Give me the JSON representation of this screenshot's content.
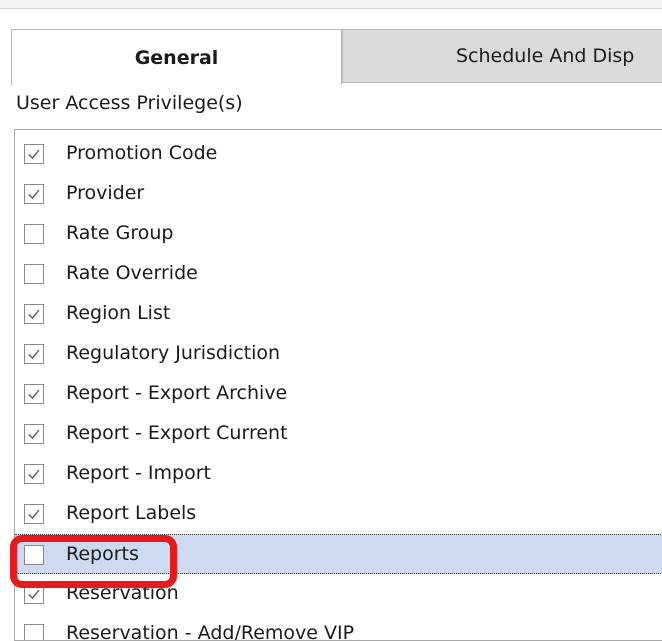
{
  "tabs": {
    "general": "General",
    "schedule": "Schedule And Disp"
  },
  "section": {
    "label": "User Access Privilege(s)"
  },
  "privileges": [
    {
      "label": "Promotion Code",
      "checked": true
    },
    {
      "label": "Provider",
      "checked": true
    },
    {
      "label": "Rate Group",
      "checked": false
    },
    {
      "label": "Rate Override",
      "checked": false
    },
    {
      "label": "Region List",
      "checked": true
    },
    {
      "label": "Regulatory Jurisdiction",
      "checked": true
    },
    {
      "label": "Report - Export Archive",
      "checked": true
    },
    {
      "label": "Report - Export Current",
      "checked": true
    },
    {
      "label": "Report - Import",
      "checked": true
    },
    {
      "label": "Report Labels",
      "checked": true
    },
    {
      "label": "Reports",
      "checked": false,
      "selected": true
    },
    {
      "label": "Reservation",
      "checked": true
    },
    {
      "label": "Reservation - Add/Remove VIP",
      "checked": false
    }
  ],
  "colors": {
    "selection": "#ccdaf2",
    "highlight": "#e8191c",
    "inactive_tab": "#dadada"
  }
}
